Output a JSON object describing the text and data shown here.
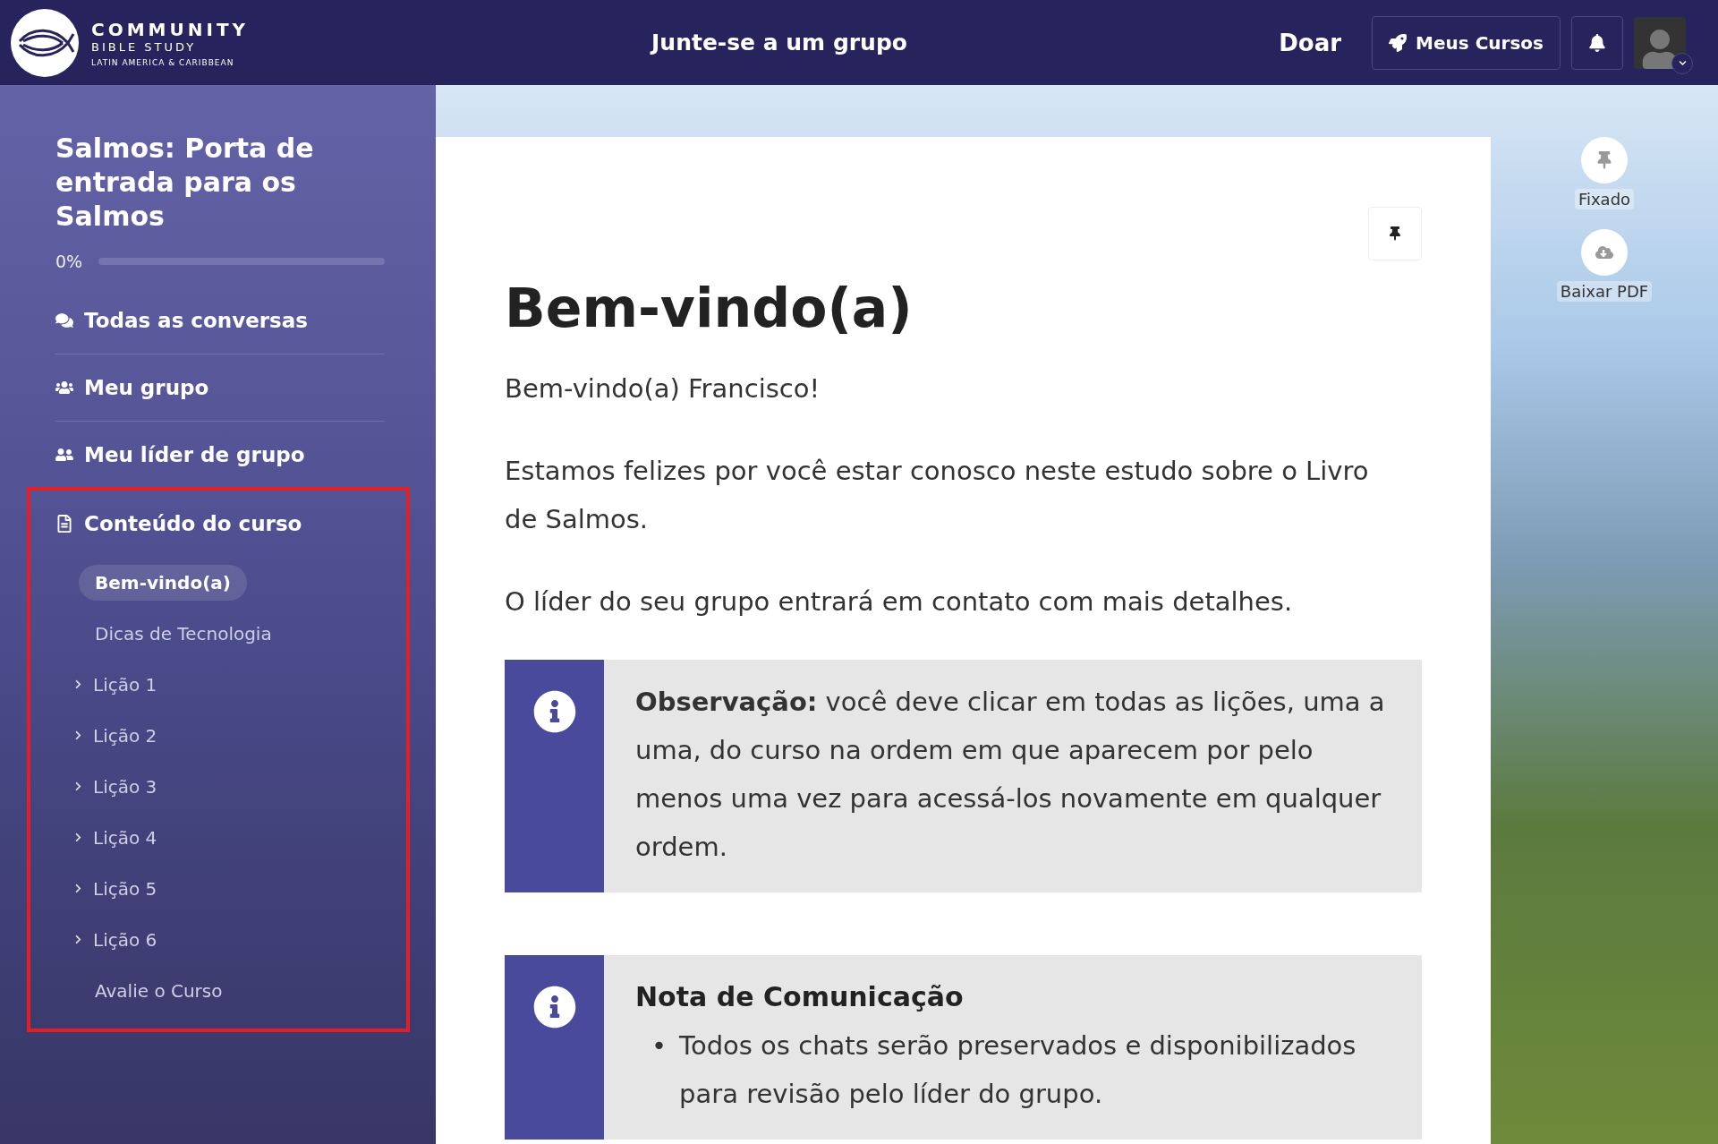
{
  "header": {
    "logo": {
      "line1": "COMMUNITY",
      "line2": "BIBLE STUDY",
      "line3": "LATIN AMERICA & CARIBBEAN"
    },
    "center_link": "Junte-se a um grupo",
    "donate_link": "Doar",
    "courses_button": "Meus Cursos"
  },
  "sidebar": {
    "course_title": "Salmos: Porta de entrada para os Salmos",
    "progress": {
      "reading": "0%",
      "level": 0
    },
    "nav": [
      {
        "kind": "chats",
        "label": "Todas as conversas"
      },
      {
        "kind": "group",
        "label": "Meu grupo"
      },
      {
        "kind": "leader",
        "label": "Meu líder de grupo"
      },
      {
        "kind": "content",
        "label": "Conteúdo do curso",
        "children": [
          {
            "label": "Bem-vindo(a)",
            "kind": "page",
            "selected": true
          },
          {
            "label": "Dicas de Tecnologia",
            "kind": "page",
            "selected": false
          },
          {
            "label": "Lição 1",
            "kind": "folder",
            "selected": false
          },
          {
            "label": "Lição 2",
            "kind": "folder",
            "selected": false
          },
          {
            "label": "Lição 3",
            "kind": "folder",
            "selected": false
          },
          {
            "label": "Lição 4",
            "kind": "folder",
            "selected": false
          },
          {
            "label": "Lição 5",
            "kind": "folder",
            "selected": false
          },
          {
            "label": "Lição 6",
            "kind": "folder",
            "selected": false
          },
          {
            "label": "Avalie o Curso",
            "kind": "page",
            "selected": false
          }
        ]
      }
    ]
  },
  "content": {
    "title": "Bem-vindo(a)",
    "paragraphs": [
      "Bem-vindo(a) Francisco!",
      "Estamos felizes por você estar conosco neste estudo sobre o Livro de Salmos.",
      "O líder do seu grupo entrará em contato com mais detalhes."
    ],
    "callouts": [
      {
        "kind": "text",
        "text": "**Observação:** você deve clicar em todas as lições, uma a uma, do curso na ordem em que aparecem por pelo menos uma vez para acessá-los novamente em qualquer ordem."
      },
      {
        "kind": "list",
        "heading": "Nota de Comunicação",
        "items": [
          {
            "marker": "•",
            "text": "Todos os chats serão preservados e disponibilizados para revisão pelo líder do grupo."
          }
        ]
      }
    ]
  },
  "side_actions": [
    {
      "kind": "pin",
      "label": "Fixado"
    },
    {
      "kind": "download",
      "label": "Baixar PDF"
    }
  ]
}
